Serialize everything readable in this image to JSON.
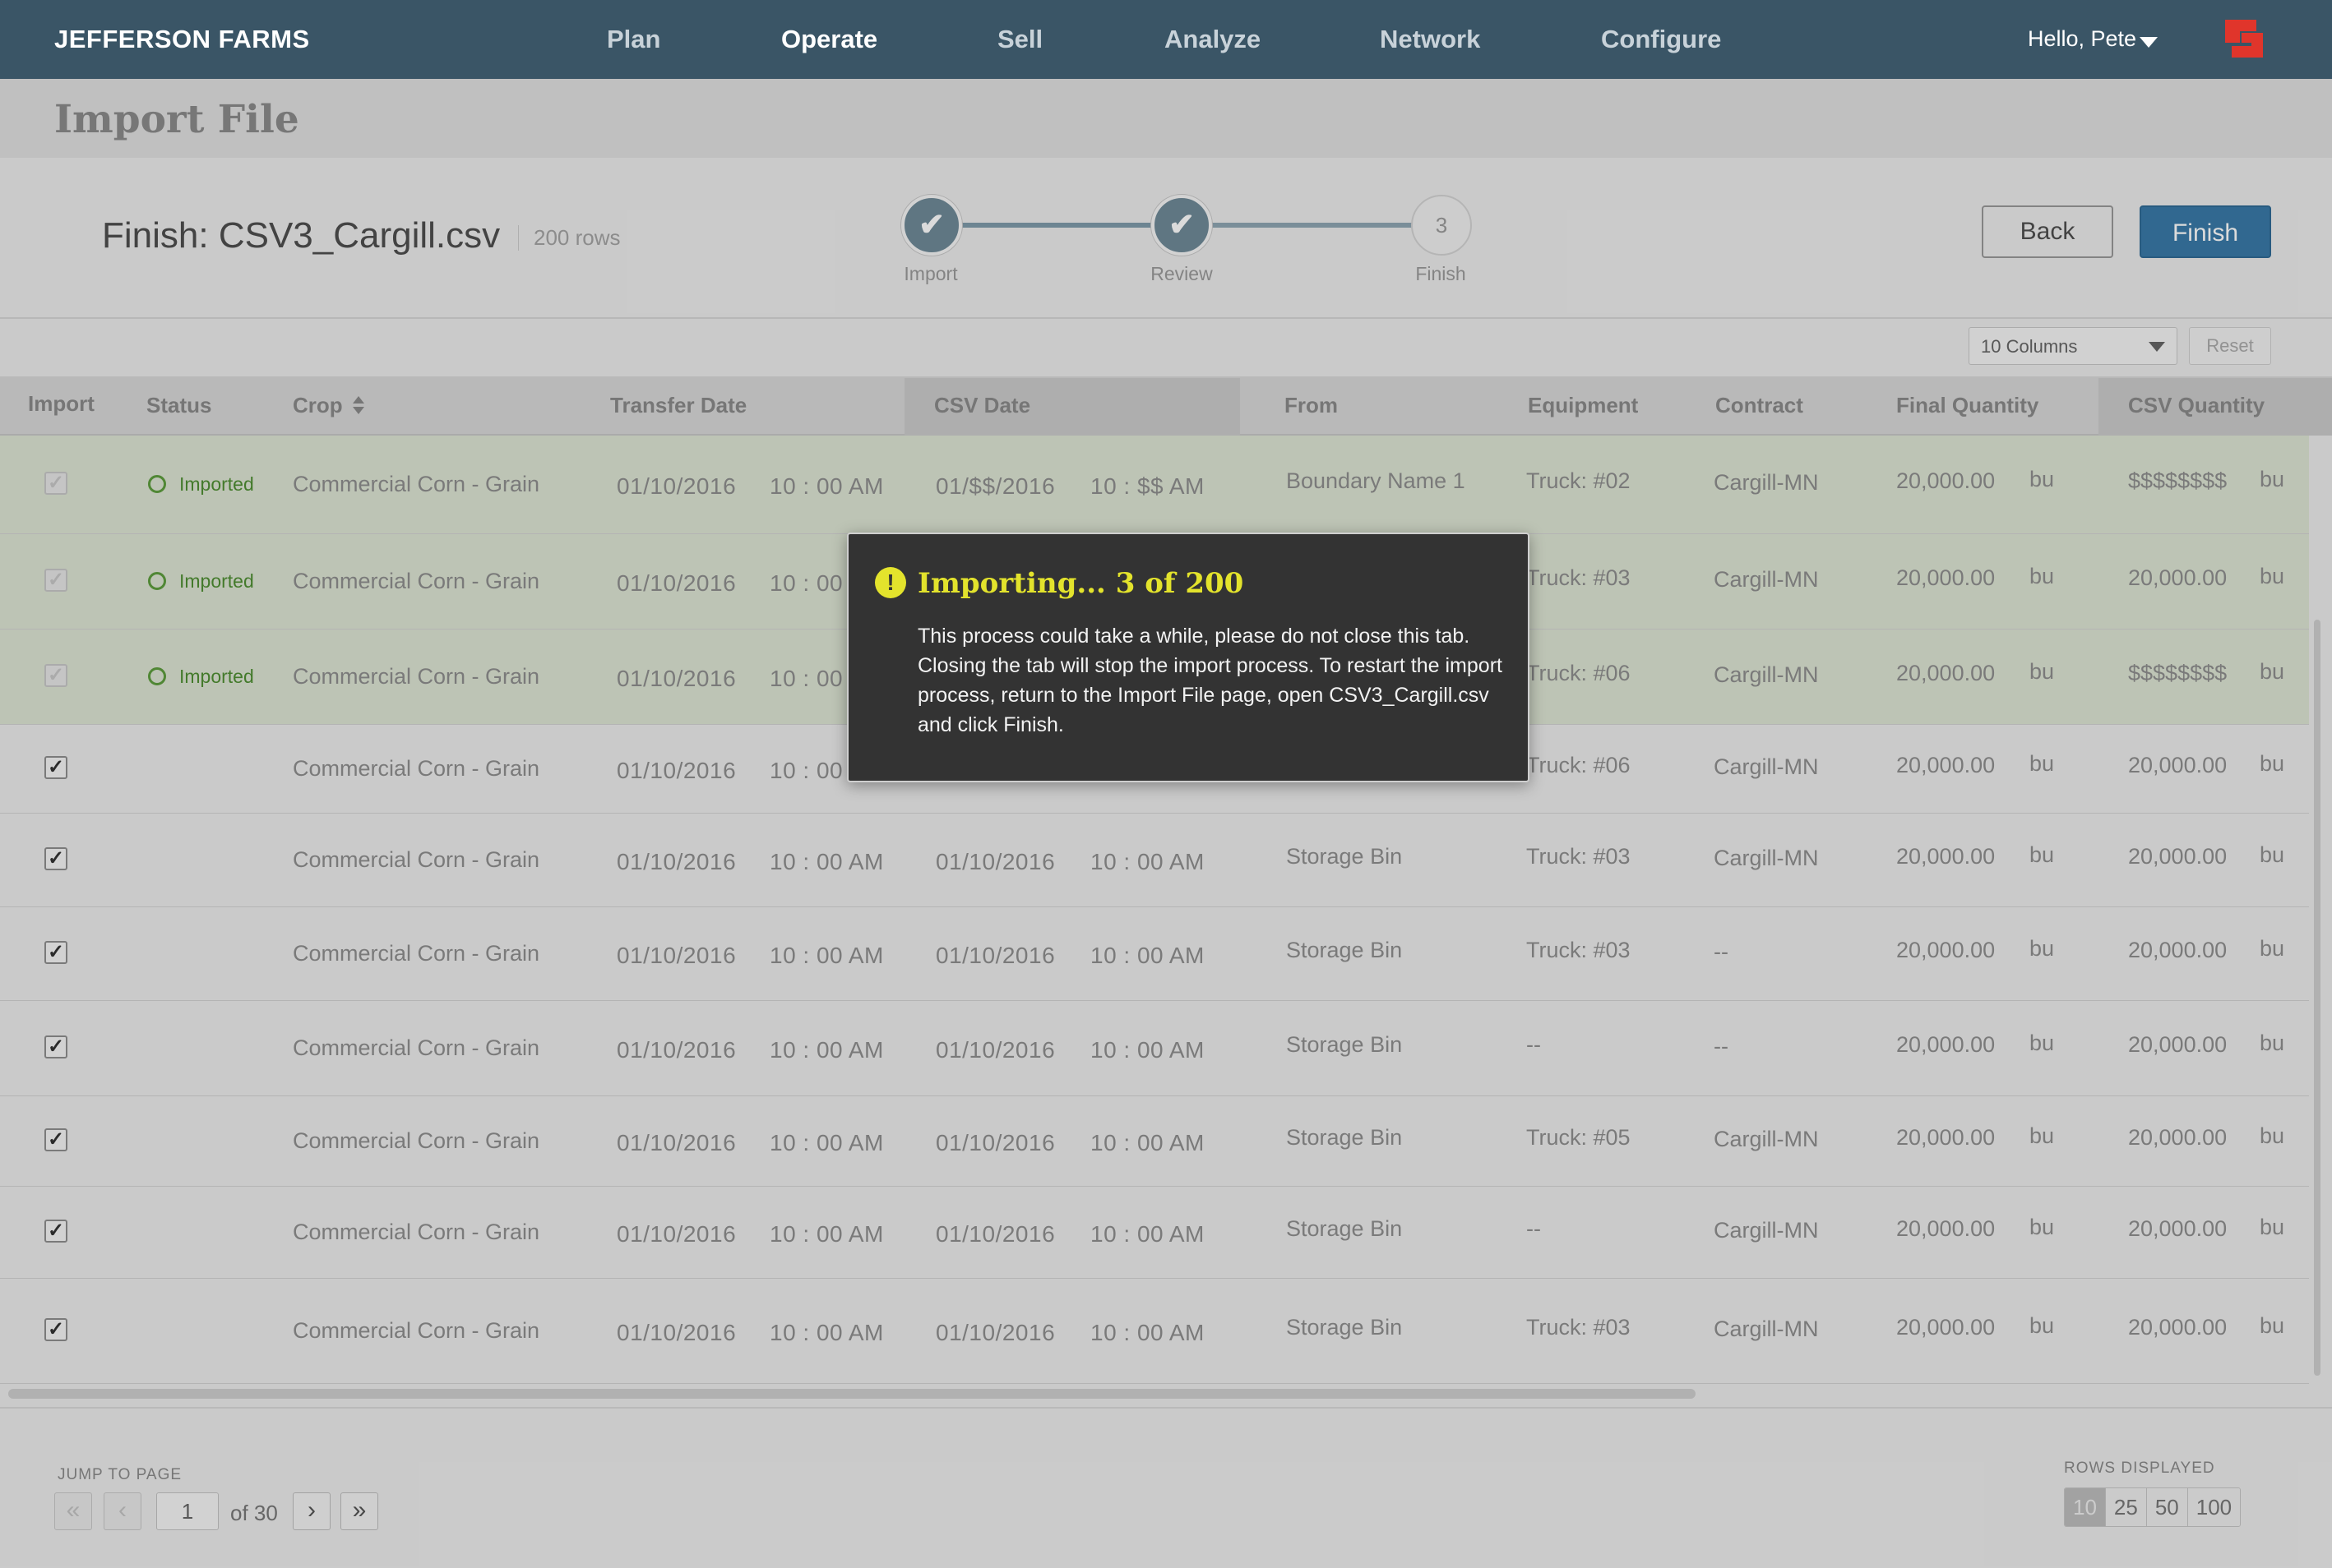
{
  "nav": {
    "brand": "JEFFERSON FARMS",
    "items": [
      {
        "label": "Plan"
      },
      {
        "label": "Operate"
      },
      {
        "label": "Sell"
      },
      {
        "label": "Analyze"
      },
      {
        "label": "Network"
      },
      {
        "label": "Configure"
      }
    ],
    "active_item": "Operate",
    "greeting": "Hello, Pete",
    "accent_color": "#e0352b"
  },
  "page": {
    "title": "Import File",
    "finish_title": "Finish: CSV3_Cargill.csv",
    "row_count": "200 rows",
    "steps": [
      {
        "label": "Import",
        "state": "done",
        "icon": "check-icon"
      },
      {
        "label": "Review",
        "state": "done",
        "icon": "check-icon"
      },
      {
        "label": "Finish",
        "state": "current",
        "number": "3"
      }
    ],
    "back_label": "Back",
    "finish_label": "Finish",
    "finish_color": "#3a7aa8"
  },
  "table_controls": {
    "columns_select": "10 Columns",
    "reset_label": "Reset"
  },
  "table": {
    "headers": [
      "Import",
      "Status",
      "Crop",
      "Transfer Date",
      "CSV Date",
      "From",
      "Equipment",
      "Contract",
      "Final Quantity",
      "CSV Quantity"
    ],
    "rows": [
      {
        "status": "Imported",
        "crop": "Commercial Corn - Grain",
        "transfer_date": "01/10/2016",
        "transfer_time": "10 : 00 AM",
        "csv_date": "01/$$/2016",
        "csv_time": "10 : $$  AM",
        "from": "Boundary Name 1",
        "equipment": "Truck: #02",
        "contract": "Cargill-MN",
        "final_qty": "20,000.00",
        "final_unit": "bu",
        "csv_qty": "$$$$$$$$",
        "csv_unit": "bu"
      },
      {
        "status": "Imported",
        "crop": "Commercial Corn - Grain",
        "transfer_date": "01/10/2016",
        "transfer_time": "10 : 00",
        "csv_date": "",
        "csv_time": "",
        "from": "",
        "equipment": "Truck: #03",
        "contract": "Cargill-MN",
        "final_qty": "20,000.00",
        "final_unit": "bu",
        "csv_qty": "20,000.00",
        "csv_unit": "bu"
      },
      {
        "status": "Imported",
        "crop": "Commercial Corn - Grain",
        "transfer_date": "01/10/2016",
        "transfer_time": "10 : 00",
        "csv_date": "",
        "csv_time": "",
        "from": "",
        "equipment": "Truck: #06",
        "contract": "Cargill-MN",
        "final_qty": "20,000.00",
        "final_unit": "bu",
        "csv_qty": "$$$$$$$$",
        "csv_unit": "bu"
      },
      {
        "status": "",
        "crop": "Commercial Corn - Grain",
        "transfer_date": "01/10/2016",
        "transfer_time": "10 : 00",
        "csv_date": "",
        "csv_time": "",
        "from": "",
        "equipment": "Truck: #06",
        "contract": "Cargill-MN",
        "final_qty": "20,000.00",
        "final_unit": "bu",
        "csv_qty": "20,000.00",
        "csv_unit": "bu"
      },
      {
        "status": "",
        "crop": "Commercial Corn - Grain",
        "transfer_date": "01/10/2016",
        "transfer_time": "10 : 00 AM",
        "csv_date": "01/10/2016",
        "csv_time": "10 : 00 AM",
        "from": "Storage Bin",
        "equipment": "Truck: #03",
        "contract": "Cargill-MN",
        "final_qty": "20,000.00",
        "final_unit": "bu",
        "csv_qty": "20,000.00",
        "csv_unit": "bu"
      },
      {
        "status": "",
        "crop": "Commercial Corn - Grain",
        "transfer_date": "01/10/2016",
        "transfer_time": "10 : 00 AM",
        "csv_date": "01/10/2016",
        "csv_time": "10 : 00 AM",
        "from": "Storage Bin",
        "equipment": "Truck: #03",
        "contract": "--",
        "final_qty": "20,000.00",
        "final_unit": "bu",
        "csv_qty": "20,000.00",
        "csv_unit": "bu"
      },
      {
        "status": "",
        "crop": "Commercial Corn - Grain",
        "transfer_date": "01/10/2016",
        "transfer_time": "10 : 00 AM",
        "csv_date": "01/10/2016",
        "csv_time": "10 : 00 AM",
        "from": "Storage Bin",
        "equipment": "--",
        "contract": "--",
        "final_qty": "20,000.00",
        "final_unit": "bu",
        "csv_qty": "20,000.00",
        "csv_unit": "bu"
      },
      {
        "status": "",
        "crop": "Commercial Corn - Grain",
        "transfer_date": "01/10/2016",
        "transfer_time": "10 : 00 AM",
        "csv_date": "01/10/2016",
        "csv_time": "10 : 00 AM",
        "from": "Storage Bin",
        "equipment": "Truck: #05",
        "contract": "Cargill-MN",
        "final_qty": "20,000.00",
        "final_unit": "bu",
        "csv_qty": "20,000.00",
        "csv_unit": "bu"
      },
      {
        "status": "",
        "crop": "Commercial Corn - Grain",
        "transfer_date": "01/10/2016",
        "transfer_time": "10 : 00 AM",
        "csv_date": "01/10/2016",
        "csv_time": "10 : 00 AM",
        "from": "Storage Bin",
        "equipment": "--",
        "contract": "Cargill-MN",
        "final_qty": "20,000.00",
        "final_unit": "bu",
        "csv_qty": "20,000.00",
        "csv_unit": "bu"
      },
      {
        "status": "",
        "crop": "Commercial Corn - Grain",
        "transfer_date": "01/10/2016",
        "transfer_time": "10 : 00 AM",
        "csv_date": "01/10/2016",
        "csv_time": "10 : 00 AM",
        "from": "Storage Bin",
        "equipment": "Truck: #03",
        "contract": "Cargill-MN",
        "final_qty": "20,000.00",
        "final_unit": "bu",
        "csv_qty": "20,000.00",
        "csv_unit": "bu"
      }
    ]
  },
  "pagination": {
    "jump_label": "JUMP TO PAGE",
    "first_glyph": "«",
    "prev_glyph": "‹",
    "next_glyph": "›",
    "last_glyph": "»",
    "current_page": "1",
    "of_label": "of 30",
    "rows_label": "ROWS DISPLAYED",
    "rows_options": [
      "10",
      "25",
      "50",
      "100"
    ],
    "rows_selected": "10"
  },
  "modal": {
    "title": "Importing... 3 of 200",
    "icon": "warning-icon",
    "icon_glyph": "!",
    "body": "This process could take a while, please do not close this tab. Closing the tab will stop the import process. To restart the import process, return to the Import File page, open CSV3_Cargill.csv and click Finish.",
    "title_color": "#e3e32c"
  }
}
